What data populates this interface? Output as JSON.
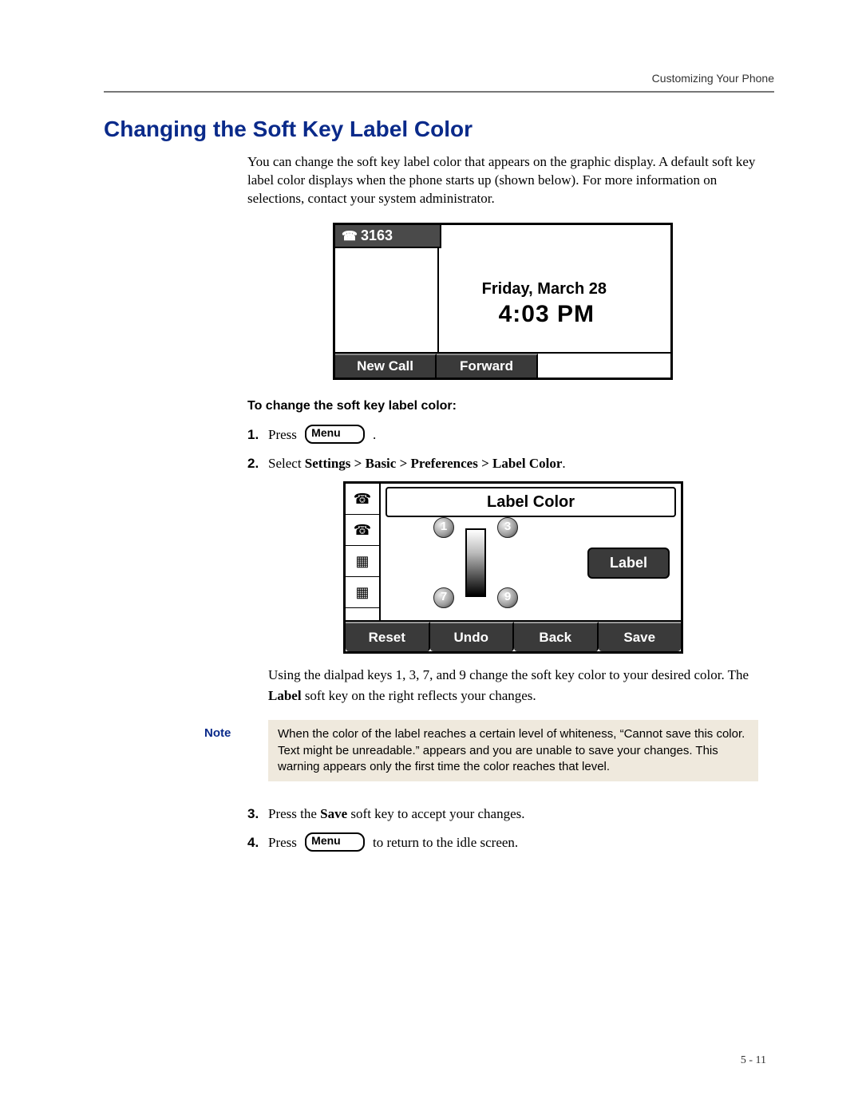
{
  "header": {
    "running": "Customizing Your Phone"
  },
  "title": "Changing the Soft Key Label Color",
  "intro": "You can change the soft key label color that appears on the graphic display. A default soft key label color displays when the phone starts up (shown below). For more information on selections, contact your system administrator.",
  "fig1": {
    "extension": "3163",
    "date": "Friday, March 28",
    "time": "4:03 PM",
    "softkeys": [
      "New Call",
      "Forward"
    ]
  },
  "subhead": "To change the soft key label color:",
  "steps": {
    "s1_num": "1.",
    "s1_press": "Press",
    "s1_menu": "Menu",
    "s1_period": ".",
    "s2_num": "2.",
    "s2_select": "Select ",
    "s2_path": "Settings > Basic > Preferences > Label Color",
    "s2_period": ".",
    "s2_after": "Using the dialpad keys 1, 3, 7, and 9 change the soft key color to your desired color. The ",
    "s2_label_word": "Label",
    "s2_after2": " soft key on the right reflects your changes.",
    "s3_num": "3.",
    "s3a": "Press the ",
    "s3b": "Save",
    "s3c": " soft key to accept your changes.",
    "s4_num": "4.",
    "s4_press": "Press",
    "s4_menu": "Menu",
    "s4_tail": " to return to the idle screen."
  },
  "fig2": {
    "title": "Label Color",
    "digits": {
      "tl": "1",
      "tr": "3",
      "bl": "7",
      "br": "9"
    },
    "label_btn": "Label",
    "softkeys": [
      "Reset",
      "Undo",
      "Back",
      "Save"
    ]
  },
  "note": {
    "label": "Note",
    "text": "When the color of the label reaches a certain level of whiteness, “Cannot save this color. Text might be unreadable.” appears and you are unable to save your changes. This warning appears only the first time the color reaches that level."
  },
  "pagenum": "5 - 11"
}
